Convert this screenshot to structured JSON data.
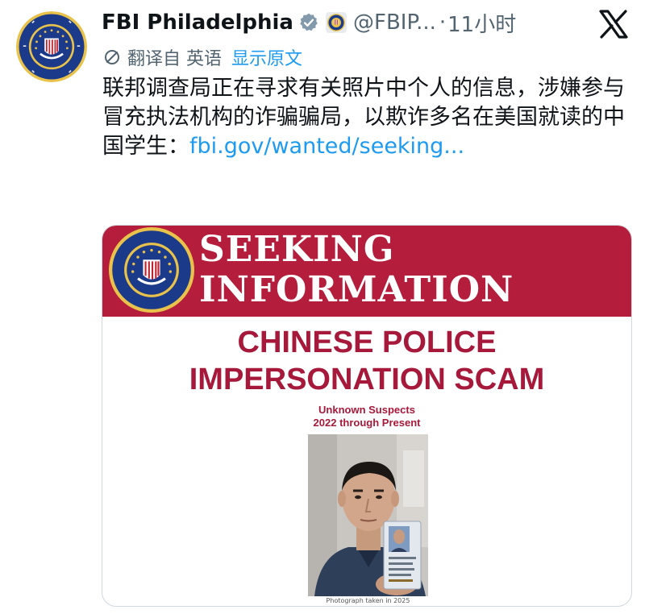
{
  "tweet": {
    "author_name": "FBI Philadelphia",
    "handle": "@FBIP...",
    "separator": "·",
    "time": "11小时",
    "translated_from": "翻译自 英语",
    "show_original": "显示原文",
    "text": "联邦调查局正在寻求有关照片中个人的信息，涉嫌参与冒充执法机构的诈骗骗局，以欺诈多名在美国就读的中国学生：",
    "link": "fbi.gov/wanted/seeking..."
  },
  "card": {
    "banner_line1": "SEEKING",
    "banner_line2": "INFORMATION",
    "headline_line1": "CHINESE POLICE",
    "headline_line2": "IMPERSONATION SCAM",
    "subline1": "Unknown Suspects",
    "subline2": "2022 through Present",
    "photo_caption": "Photograph taken in 2025"
  },
  "icons": {
    "verified": "verified-badge-icon",
    "org": "fbi-seal-icon",
    "platform": "x-logo-icon",
    "translate": "translate-icon"
  },
  "colors": {
    "link_blue": "#1d9bf0",
    "secondary_text": "#536471",
    "banner_red": "#b41e3c",
    "headline_red": "#a6193a"
  }
}
